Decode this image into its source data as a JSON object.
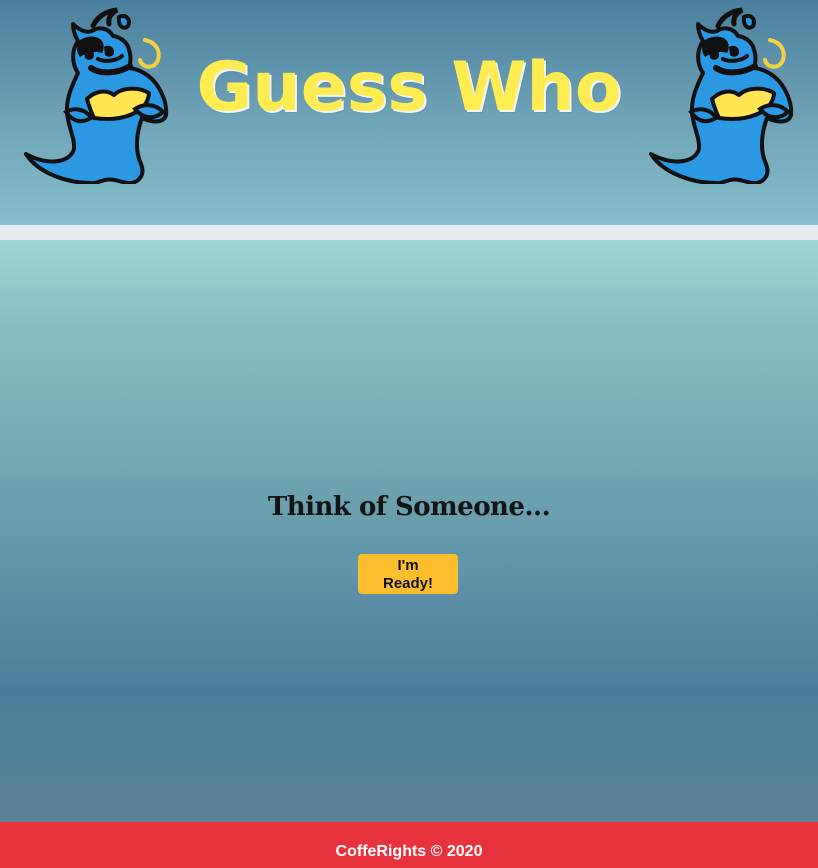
{
  "header": {
    "title": "Guess Who",
    "left_mascot": "genie-icon",
    "right_mascot": "genie-icon"
  },
  "main": {
    "prompt": "Think of Someone...",
    "ready_button_label": "I'm Ready!"
  },
  "footer": {
    "copyright": "CoffeRights © 2020"
  },
  "colors": {
    "title": "#ffec51",
    "button": "#fdbe2e",
    "footer": "#e8333f",
    "genie": "#2a98e2"
  }
}
